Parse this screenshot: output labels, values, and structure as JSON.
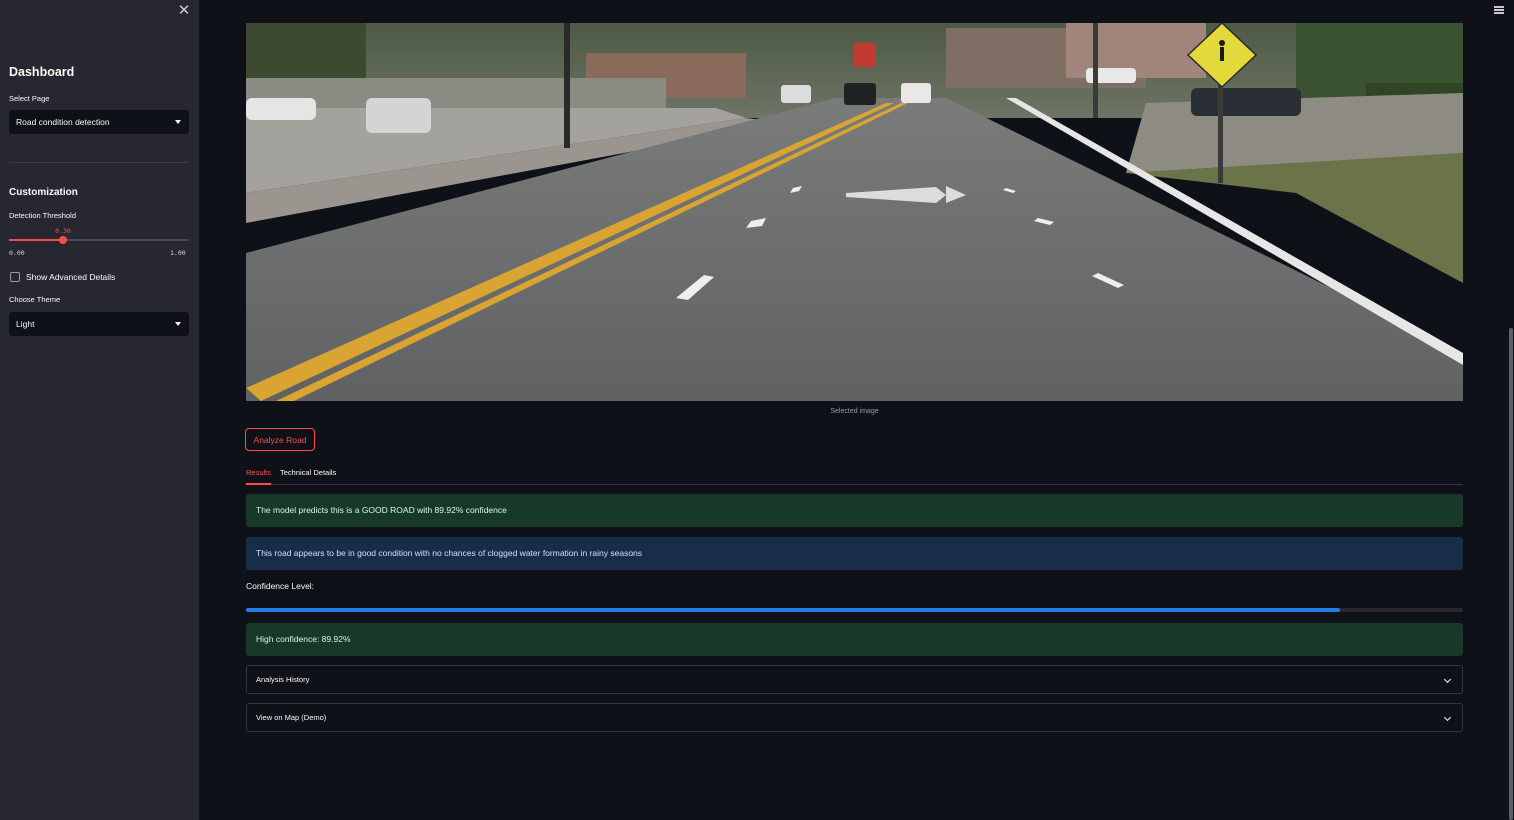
{
  "sidebar": {
    "title": "Dashboard",
    "select_page_label": "Select Page",
    "select_page_value": "Road condition detection",
    "customization_heading": "Customization",
    "threshold_label": "Detection Threshold",
    "threshold_value": "0.30",
    "threshold_fraction": 0.3,
    "threshold_min": "0.00",
    "threshold_max": "1.00",
    "checkbox_label": "Show Advanced Details",
    "checkbox_checked": false,
    "theme_label": "Choose Theme",
    "theme_value": "Light"
  },
  "main": {
    "image_caption": "Selected image",
    "analyze_button": "Analyze Road",
    "tabs": [
      {
        "label": "Results",
        "active": true
      },
      {
        "label": "Technical Details",
        "active": false
      }
    ],
    "prediction_text": "The model predicts this is a GOOD ROAD with 89.92% confidence",
    "info_text": "This road appears to be in good condition with no chances of clogged water formation in rainy seasons",
    "confidence_label": "Confidence Level:",
    "confidence_value": 0.8992,
    "confidence_text": "High confidence: 89.92%",
    "expanders": [
      {
        "label": "Analysis History"
      },
      {
        "label": "View on Map (Demo)"
      }
    ]
  },
  "colors": {
    "accent": "#ff4b4b",
    "success_bg": "#173928",
    "info_bg": "#172d48",
    "progress": "#1f7de6",
    "sidebar_bg": "#262730",
    "main_bg": "#0e1117"
  },
  "icons": {
    "close": "close-icon",
    "menu": "hamburger-menu-icon",
    "dropdown": "chevron-down-icon"
  }
}
